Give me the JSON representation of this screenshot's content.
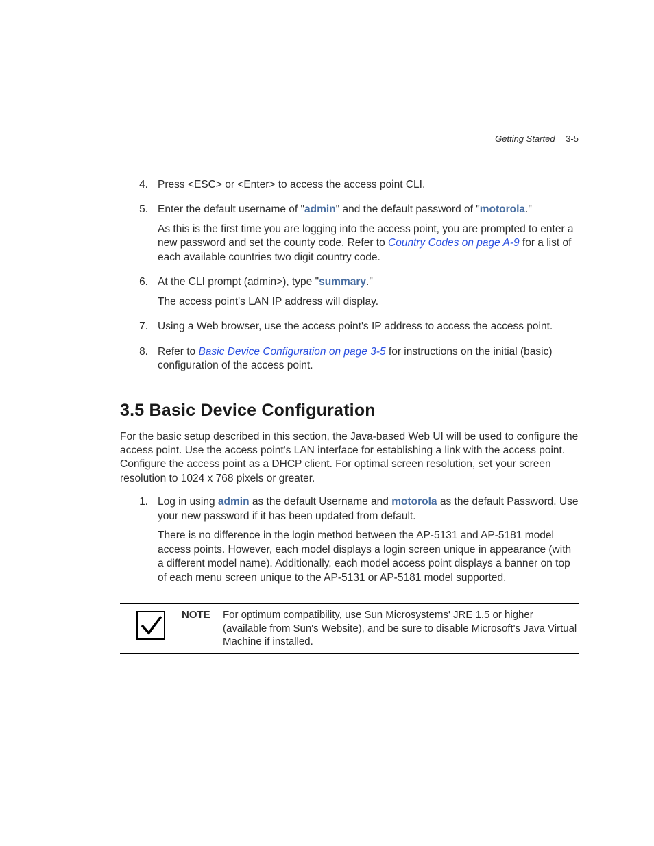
{
  "header": {
    "section": "Getting Started",
    "pagenum": "3-5"
  },
  "steps_a": [
    {
      "num": "4.",
      "paras": [
        [
          {
            "t": "Press <ESC> or <Enter> to access the access point CLI."
          }
        ]
      ]
    },
    {
      "num": "5.",
      "paras": [
        [
          {
            "t": "Enter the default username of \""
          },
          {
            "t": "admin",
            "cls": "cmd"
          },
          {
            "t": "\" and the default password of \""
          },
          {
            "t": "motorola",
            "cls": "cmd"
          },
          {
            "t": ".\""
          }
        ],
        [
          {
            "t": "As this is the first time you are logging into the access point, you are prompted to enter a new password and set the county code. Refer to "
          },
          {
            "t": "Country Codes on page A-9",
            "cls": "link"
          },
          {
            "t": " for a list of each available countries two digit country code."
          }
        ]
      ]
    },
    {
      "num": "6.",
      "paras": [
        [
          {
            "t": "At the CLI prompt (admin>), type \""
          },
          {
            "t": "summary",
            "cls": "cmd"
          },
          {
            "t": ".\""
          }
        ],
        [
          {
            "t": "The access point's LAN IP address will display."
          }
        ]
      ]
    },
    {
      "num": "7.",
      "paras": [
        [
          {
            "t": "Using a Web browser, use the access point's IP address to access the access point."
          }
        ]
      ]
    },
    {
      "num": "8.",
      "paras": [
        [
          {
            "t": "Refer to "
          },
          {
            "t": "Basic Device Configuration on page 3-5",
            "cls": "link"
          },
          {
            "t": " for instructions on the initial (basic) configuration of the access point."
          }
        ]
      ]
    }
  ],
  "section_title": "3.5  Basic Device Configuration",
  "intro_para": "For the basic setup described in this section, the Java-based Web UI will be used to configure the access point. Use the access point's LAN interface for establishing a link with the access point. Configure the access point as a DHCP client. For optimal screen resolution, set your screen resolution to 1024 x 768 pixels or greater.",
  "steps_b": [
    {
      "num": "1.",
      "paras": [
        [
          {
            "t": "Log in using "
          },
          {
            "t": "admin",
            "cls": "cmd"
          },
          {
            "t": " as the default Username and "
          },
          {
            "t": "motorola",
            "cls": "cmd"
          },
          {
            "t": " as the default Password. Use your new password if it has been updated from default."
          }
        ],
        [
          {
            "t": "There is no difference in the login method between the AP-5131 and AP-5181 model access points. However, each model displays a login screen unique in appearance (with a different model name). Additionally, each model access point displays a banner on top of each menu screen unique to the AP-5131 or AP-5181 model supported."
          }
        ]
      ]
    }
  ],
  "note": {
    "label": "NOTE",
    "text": "For optimum compatibility, use Sun Microsystems' JRE 1.5 or higher (available from Sun's Website), and be sure to disable Microsoft's Java Virtual Machine if installed."
  }
}
